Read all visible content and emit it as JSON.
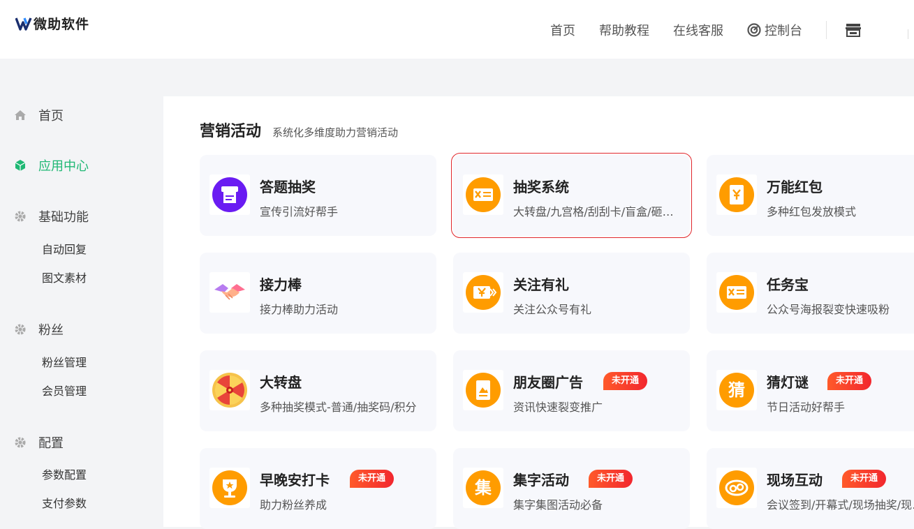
{
  "header": {
    "brand": "微助软件",
    "nav": [
      {
        "label": "首页"
      },
      {
        "label": "帮助教程"
      },
      {
        "label": "在线客服"
      }
    ],
    "console_label": "控制台",
    "icons": {
      "console": "compass-icon",
      "shop": "store-icon"
    }
  },
  "sidebar": {
    "items": [
      {
        "label": "首页",
        "icon": "home-icon",
        "active": false
      },
      {
        "label": "应用中心",
        "icon": "cube-icon",
        "active": true
      },
      {
        "label": "基础功能",
        "icon": "gear-icon",
        "active": false,
        "children": [
          {
            "label": "自动回复"
          },
          {
            "label": "图文素材"
          }
        ]
      },
      {
        "label": "粉丝",
        "icon": "gear-icon",
        "active": false,
        "children": [
          {
            "label": "粉丝管理"
          },
          {
            "label": "会员管理"
          }
        ]
      },
      {
        "label": "配置",
        "icon": "gear-icon",
        "active": false,
        "children": [
          {
            "label": "参数配置"
          },
          {
            "label": "支付参数"
          }
        ]
      }
    ],
    "active_color": "#1fb874"
  },
  "main": {
    "section_title": "营销活动",
    "section_subtitle": "系统化多维度助力营销活动",
    "badge_label": "未开通",
    "apps": [
      {
        "title": "答题抽奖",
        "desc": "宣传引流好帮手",
        "icon": "quiz-printer-icon",
        "badge": false,
        "selected": false
      },
      {
        "title": "抽奖系统",
        "desc": "大转盘/九宫格/刮刮卡/盲盒/砸金蛋",
        "icon": "lottery-ticket-icon",
        "badge": false,
        "selected": true
      },
      {
        "title": "万能红包",
        "desc": "多种红包发放模式",
        "icon": "red-packet-icon",
        "badge": false,
        "selected": false
      },
      {
        "title": "接力棒",
        "desc": "接力棒助力活动",
        "icon": "handshake-icon",
        "badge": false,
        "selected": false
      },
      {
        "title": "关注有礼",
        "desc": "关注公众号有礼",
        "icon": "yuan-coupon-icon",
        "badge": false,
        "selected": false
      },
      {
        "title": "任务宝",
        "desc": "公众号海报裂变快速吸粉",
        "icon": "task-ticket-icon",
        "badge": false,
        "selected": false
      },
      {
        "title": "大转盘",
        "desc": "多种抽奖模式-普通/抽奖码/积分",
        "icon": "prize-wheel-icon",
        "badge": false,
        "selected": false
      },
      {
        "title": "朋友圈广告",
        "desc": "资讯快速裂变推广",
        "icon": "ad-poster-icon",
        "badge": true,
        "selected": false
      },
      {
        "title": "猜灯谜",
        "desc": "节日活动好帮手",
        "icon": "riddle-icon",
        "icon_text": "猜",
        "badge": true,
        "selected": false
      },
      {
        "title": "早晚安打卡",
        "desc": "助力粉丝养成",
        "icon": "trophy-icon",
        "badge": true,
        "selected": false
      },
      {
        "title": "集字活动",
        "desc": "集字集图活动必备",
        "icon": "collect-words-icon",
        "icon_text": "集",
        "badge": true,
        "selected": false
      },
      {
        "title": "现场互动",
        "desc": "会议签到/开幕式/现场抽奖/现场互动",
        "icon": "interaction-icon",
        "badge": true,
        "selected": false
      }
    ],
    "icon_color": "#ff9c00"
  }
}
